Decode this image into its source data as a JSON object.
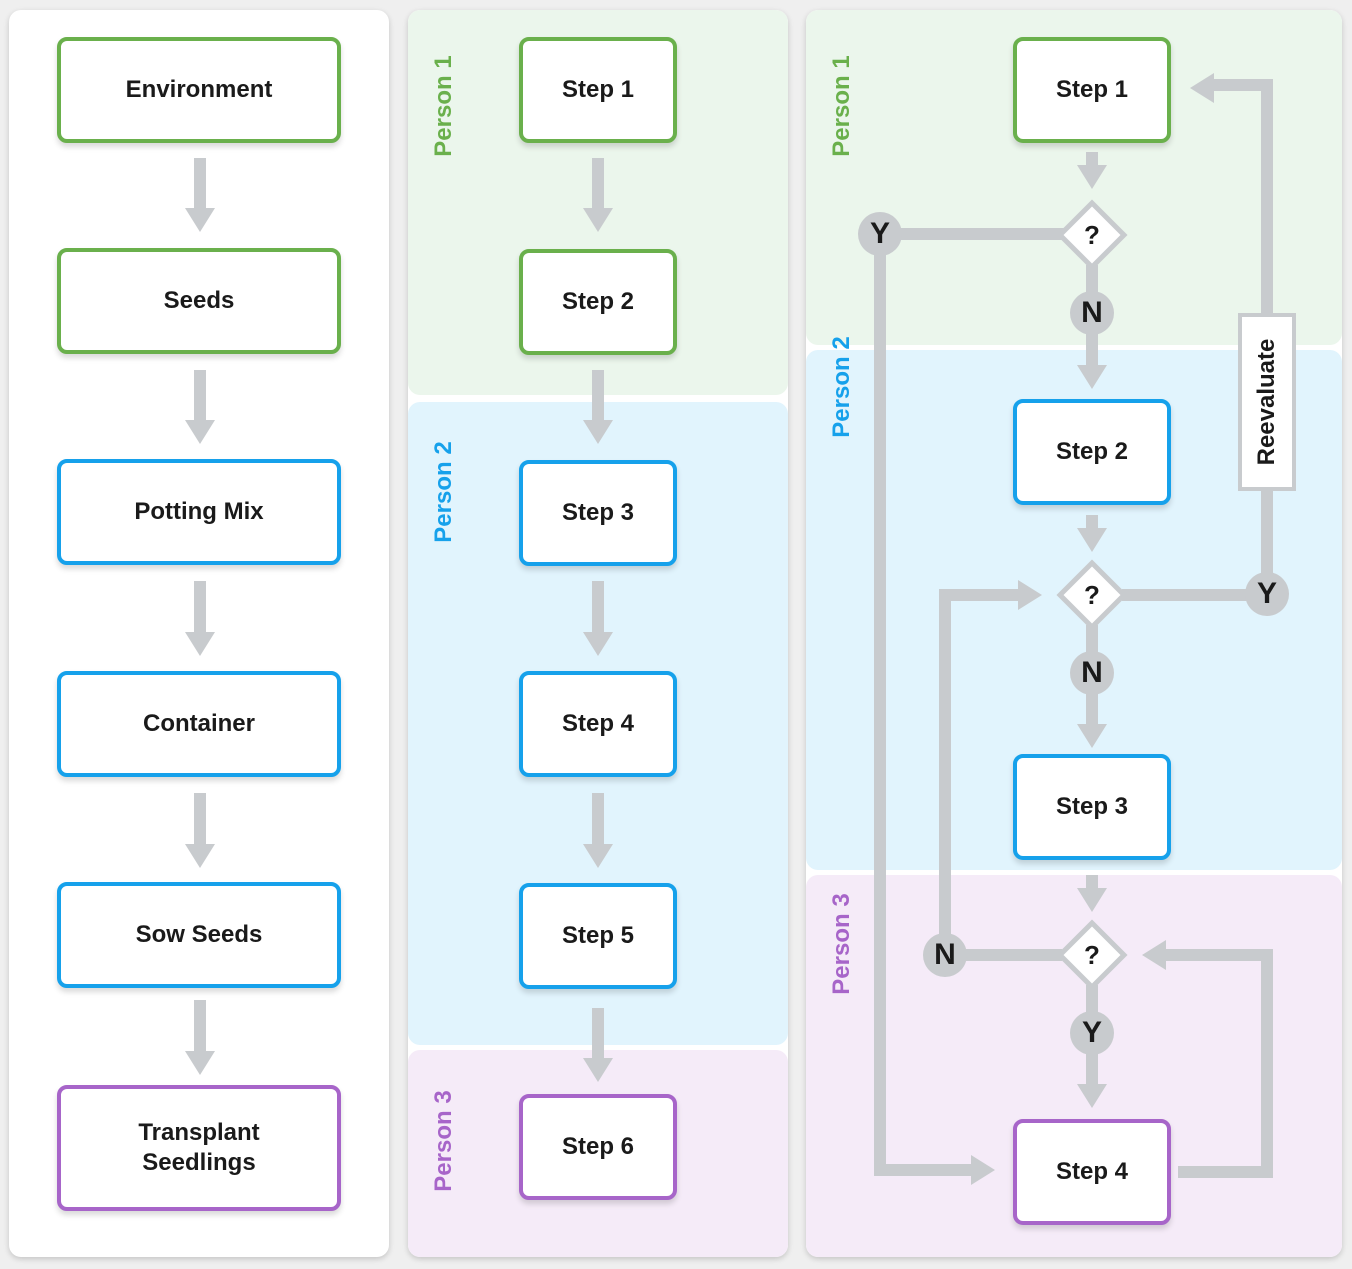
{
  "colors": {
    "person1": "#6ab04c",
    "person2": "#16a1eb",
    "person3": "#a765c9",
    "connector": "#c8cbce",
    "lane_person1_bg": "#ebf6ec",
    "lane_person2_bg": "#e1f4fd",
    "lane_person3_bg": "#f5ebf8"
  },
  "simple_flow": {
    "steps": [
      {
        "label": "Environment",
        "owner": "person1"
      },
      {
        "label": "Seeds",
        "owner": "person1"
      },
      {
        "label": "Potting Mix",
        "owner": "person2"
      },
      {
        "label": "Container",
        "owner": "person2"
      },
      {
        "label": "Sow Seeds",
        "owner": "person2"
      },
      {
        "label": "Transplant\nSeedlings",
        "owner": "person3"
      }
    ]
  },
  "swimlane_flow": {
    "lanes": [
      {
        "label": "Person 1"
      },
      {
        "label": "Person 2"
      },
      {
        "label": "Person 3"
      }
    ],
    "steps": [
      {
        "label": "Step 1",
        "owner": "person1"
      },
      {
        "label": "Step 2",
        "owner": "person1"
      },
      {
        "label": "Step 3",
        "owner": "person2"
      },
      {
        "label": "Step 4",
        "owner": "person2"
      },
      {
        "label": "Step 5",
        "owner": "person2"
      },
      {
        "label": "Step 6",
        "owner": "person3"
      }
    ]
  },
  "decision_flow": {
    "lanes": [
      {
        "label": "Person 1"
      },
      {
        "label": "Person 2"
      },
      {
        "label": "Person 3"
      }
    ],
    "steps": [
      {
        "label": "Step 1",
        "owner": "person1"
      },
      {
        "label": "Step 2",
        "owner": "person2"
      },
      {
        "label": "Step 3",
        "owner": "person2"
      },
      {
        "label": "Step 4",
        "owner": "person3"
      }
    ],
    "decisions": [
      {
        "label": "?",
        "yes": "Y",
        "no": "N"
      },
      {
        "label": "?",
        "yes": "Y",
        "no": "N"
      },
      {
        "label": "?",
        "yes": "Y",
        "no": "N"
      }
    ],
    "reevaluate_label": "Reevaluate"
  }
}
